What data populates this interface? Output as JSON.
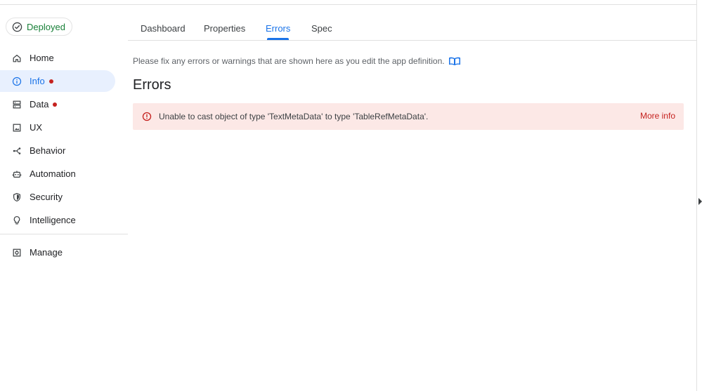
{
  "status_chip": {
    "label": "Deployed",
    "icon": "check-circle-icon",
    "color": "#188038"
  },
  "sidebar": {
    "items": [
      {
        "key": "home",
        "label": "Home",
        "icon": "home-icon",
        "active": false,
        "dot": false
      },
      {
        "key": "info",
        "label": "Info",
        "icon": "info-icon",
        "active": true,
        "dot": true
      },
      {
        "key": "data",
        "label": "Data",
        "icon": "database-icon",
        "active": false,
        "dot": true
      },
      {
        "key": "ux",
        "label": "UX",
        "icon": "ux-icon",
        "active": false,
        "dot": false
      },
      {
        "key": "behavior",
        "label": "Behavior",
        "icon": "behavior-icon",
        "active": false,
        "dot": false
      },
      {
        "key": "automation",
        "label": "Automation",
        "icon": "robot-icon",
        "active": false,
        "dot": false
      },
      {
        "key": "security",
        "label": "Security",
        "icon": "shield-icon",
        "active": false,
        "dot": false
      },
      {
        "key": "intelligence",
        "label": "Intelligence",
        "icon": "lightbulb-icon",
        "active": false,
        "dot": false
      }
    ],
    "manage": {
      "label": "Manage",
      "icon": "manage-icon"
    }
  },
  "tabs": [
    {
      "label": "Dashboard",
      "active": false
    },
    {
      "label": "Properties",
      "active": false
    },
    {
      "label": "Errors",
      "active": true
    },
    {
      "label": "Spec",
      "active": false
    }
  ],
  "main": {
    "hint": "Please fix any errors or warnings that are shown here as you edit the app definition.",
    "title": "Errors",
    "error": {
      "message": "Unable to cast object of type 'TextMetaData' to type 'TableRefMetaData'.",
      "action": "More info"
    }
  },
  "colors": {
    "accent": "#1a73e8",
    "active_bg": "#e8f0fe",
    "error_bg": "#fce8e6",
    "error": "#c5221f"
  }
}
